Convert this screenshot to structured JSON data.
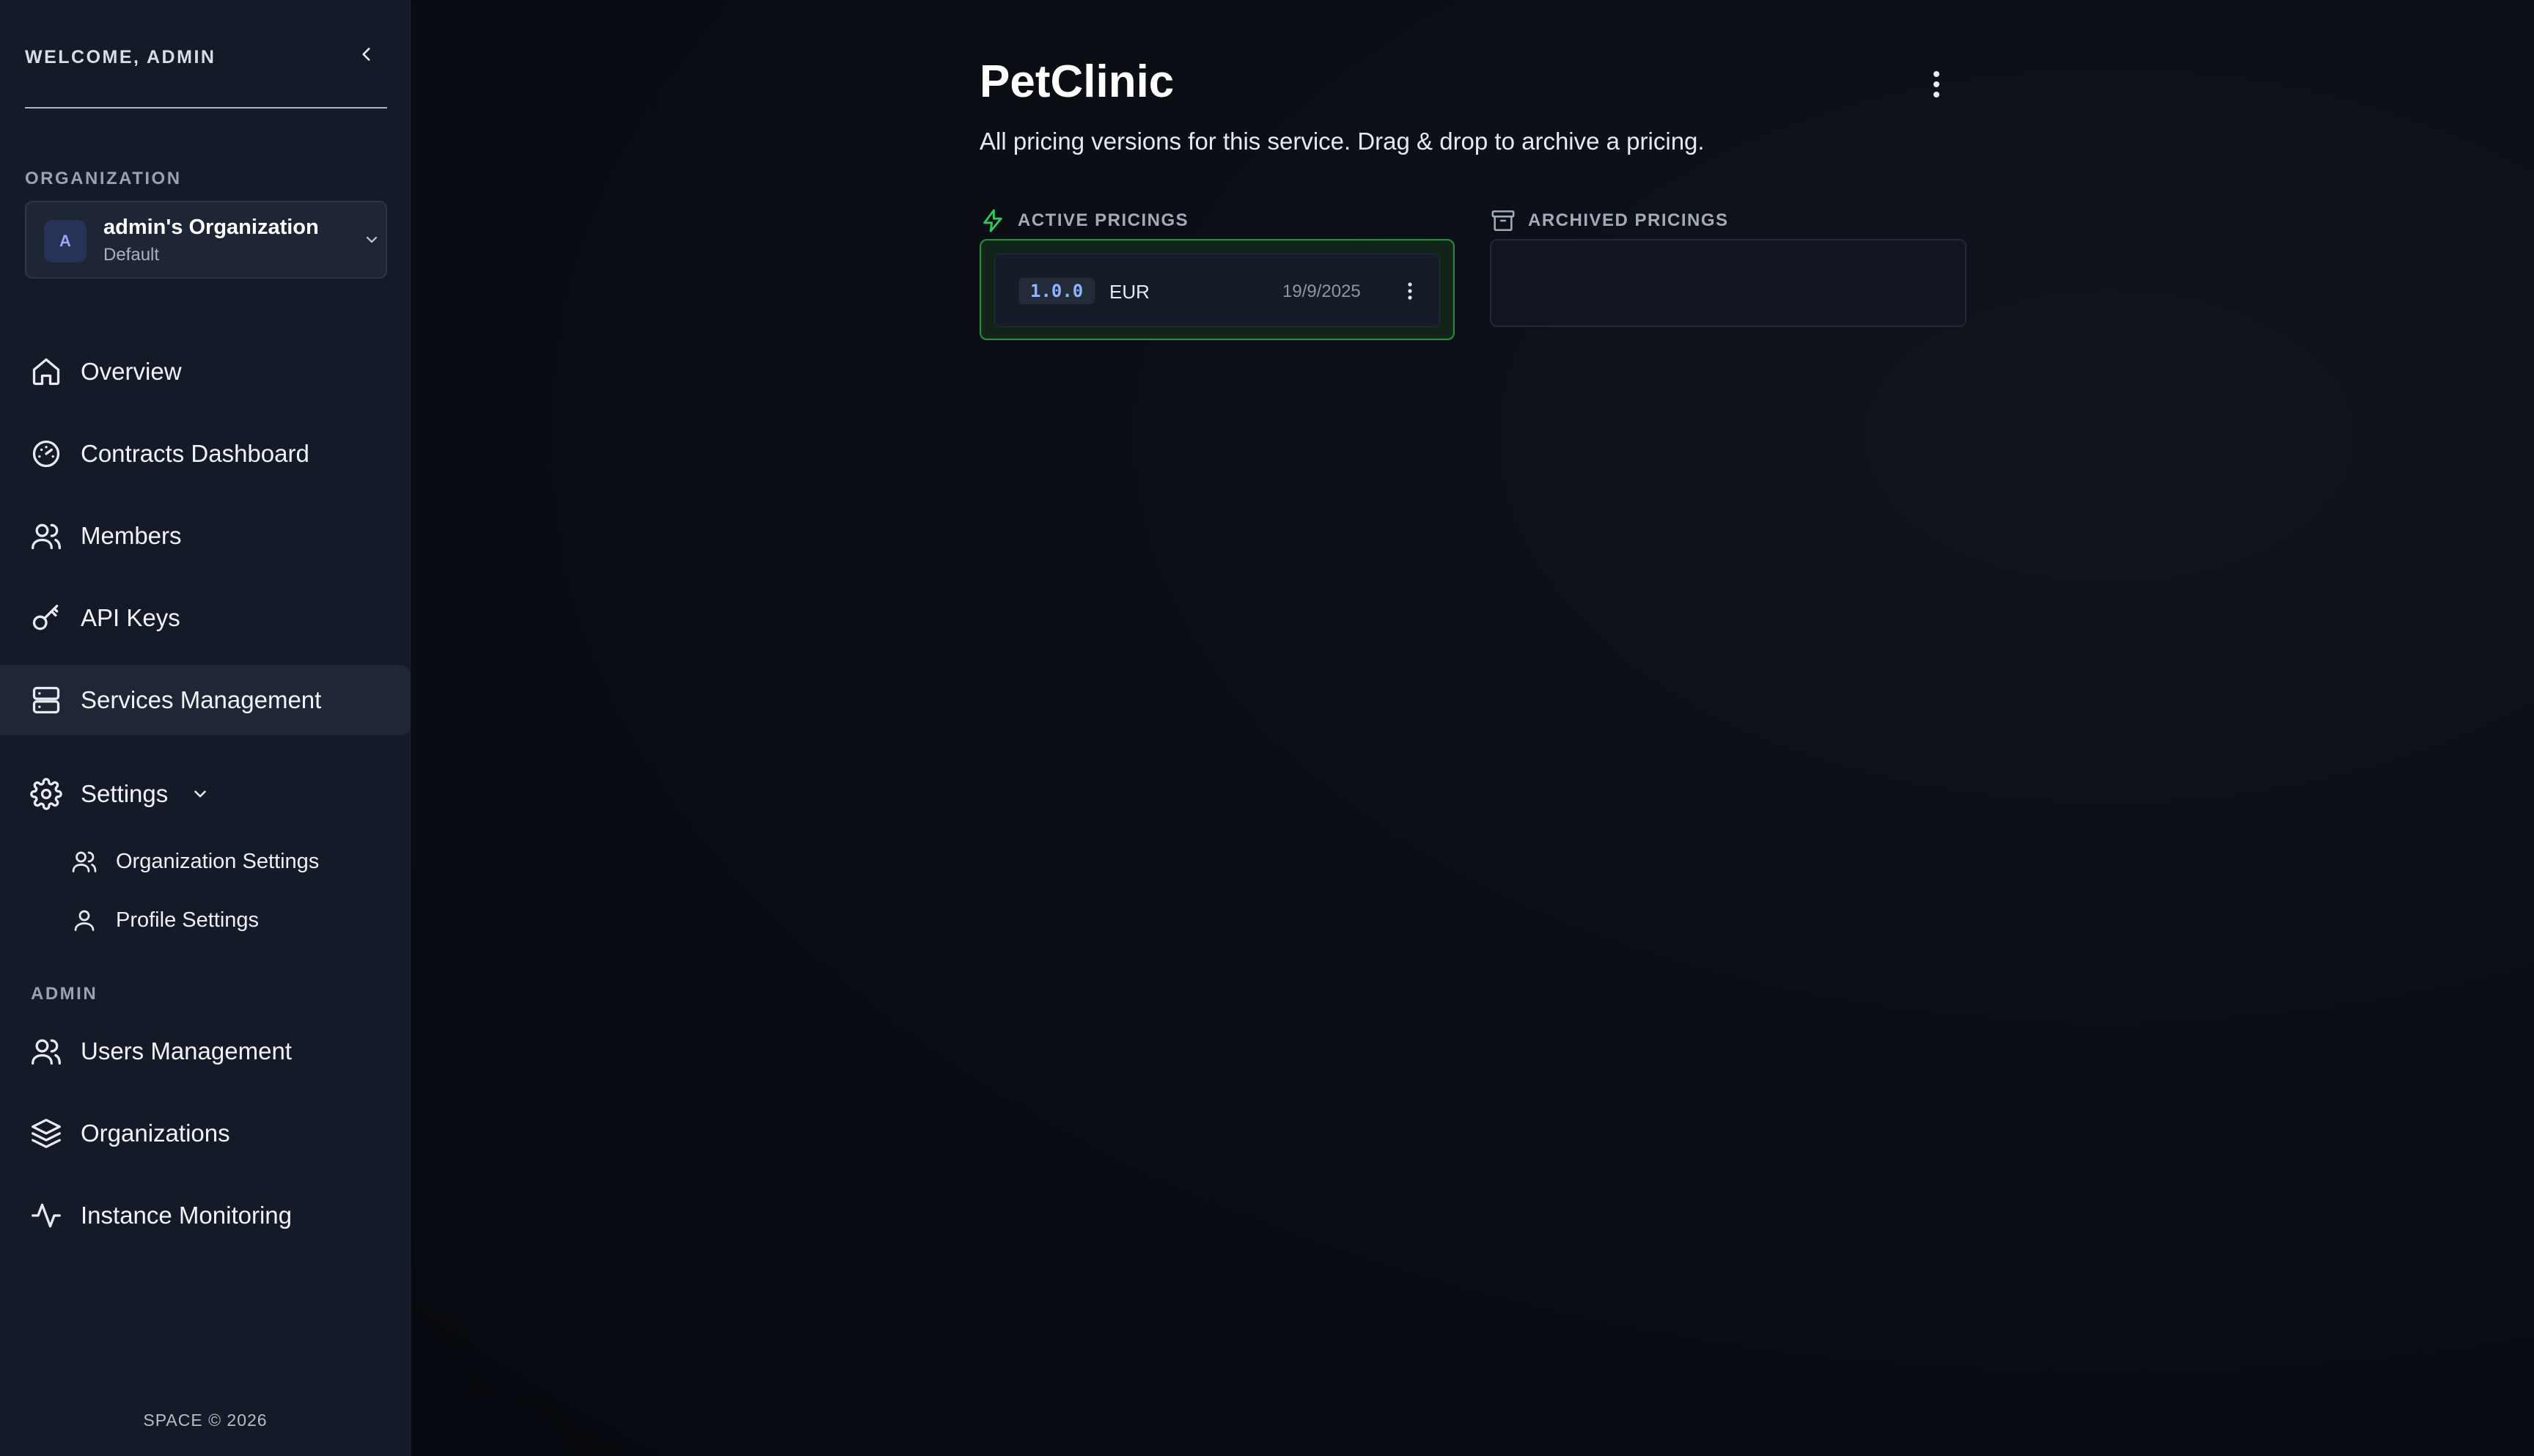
{
  "sidebar": {
    "welcome": "WELCOME, ADMIN",
    "organization_label": "ORGANIZATION",
    "org_selector": {
      "avatar_letter": "A",
      "name": "admin's Organization",
      "subtitle": "Default"
    },
    "nav_items": [
      {
        "label": "Overview",
        "icon": "home-icon"
      },
      {
        "label": "Contracts Dashboard",
        "icon": "gauge-icon"
      },
      {
        "label": "Members",
        "icon": "users-icon"
      },
      {
        "label": "API Keys",
        "icon": "key-icon"
      },
      {
        "label": "Services Management",
        "icon": "server-icon",
        "active": true
      },
      {
        "label": "Settings",
        "icon": "gear-icon",
        "expanded": true
      }
    ],
    "settings_sub_items": [
      {
        "label": "Organization Settings",
        "icon": "users-icon"
      },
      {
        "label": "Profile Settings",
        "icon": "user-icon"
      }
    ],
    "admin_label": "ADMIN",
    "admin_items": [
      {
        "label": "Users Management",
        "icon": "users-icon"
      },
      {
        "label": "Organizations",
        "icon": "layers-icon"
      },
      {
        "label": "Instance Monitoring",
        "icon": "activity-icon"
      }
    ],
    "footer": "SPACE © 2026"
  },
  "main": {
    "title": "PetClinic",
    "subtitle": "All pricing versions for this service. Drag & drop to archive a pricing.",
    "active_header": "ACTIVE PRICINGS",
    "archived_header": "ARCHIVED PRICINGS",
    "active_pricings": [
      {
        "version": "1.0.0",
        "currency": "EUR",
        "date": "19/9/2025"
      }
    ],
    "archived_pricings": []
  },
  "colors": {
    "sidebar_bg": "#141a27",
    "main_bg": "#0b0e15",
    "active_border": "#2a8a3e",
    "accent_green": "#34c759",
    "version_text": "#8fb4ff"
  }
}
